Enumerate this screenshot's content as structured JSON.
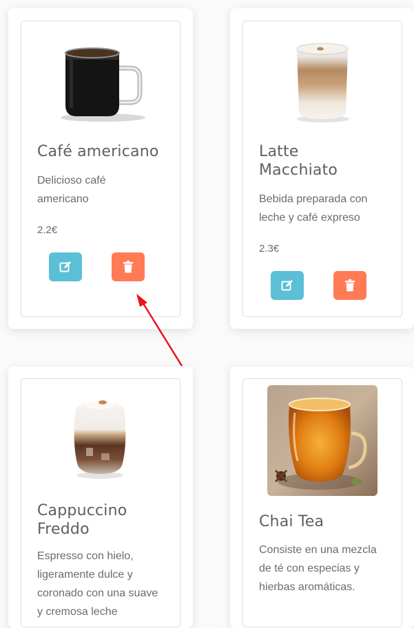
{
  "products": [
    {
      "name": "Café americano",
      "description": "Delicioso café americano",
      "price": "2.2€",
      "image_icon": "coffee-mug-icon"
    },
    {
      "name": "Latte Macchiato",
      "description": "Bebida preparada con leche y café expreso",
      "price": "2.3€",
      "image_icon": "latte-glass-icon"
    },
    {
      "name": "Cappuccino Freddo",
      "description": "Espresso con hielo, ligeramente dulce y coronado con una suave y cremosa leche",
      "image_icon": "iced-coffee-glass-icon"
    },
    {
      "name": "Chai Tea",
      "description": "Consiste en una mezcla de té con especias y hierbas aromáticas.",
      "image_icon": "tea-cup-icon"
    }
  ],
  "buttons": {
    "edit_icon": "edit-icon",
    "delete_icon": "trash-icon",
    "edit_color": "#5bbfd6",
    "delete_color": "#ff7b55"
  },
  "annotation": {
    "arrow_color": "#e8141b"
  }
}
